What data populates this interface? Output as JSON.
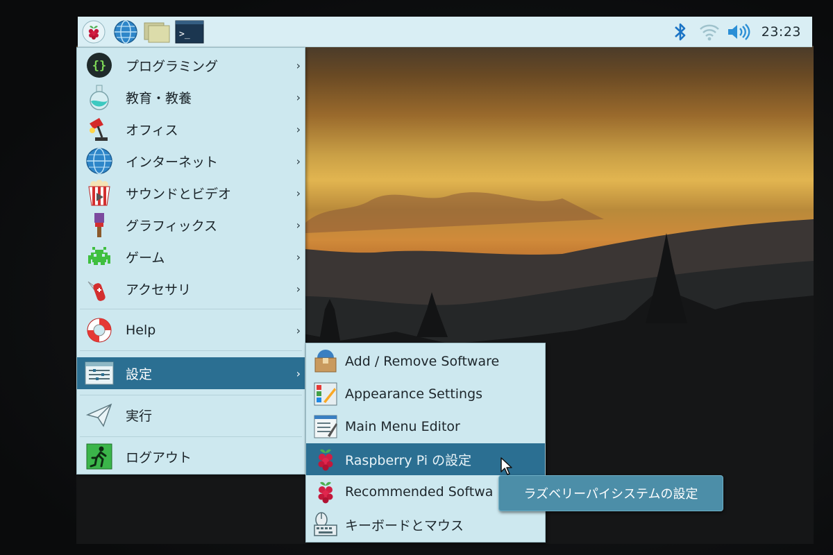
{
  "panel": {
    "launchers": [
      {
        "name": "raspberry-menu",
        "icon": "raspberry-icon"
      },
      {
        "name": "web-browser",
        "icon": "globe-icon"
      },
      {
        "name": "file-manager",
        "icon": "folder-icon"
      },
      {
        "name": "terminal",
        "icon": "terminal-icon"
      }
    ],
    "tray": [
      "bluetooth-icon",
      "wifi-icon",
      "volume-icon"
    ],
    "clock": "23:23"
  },
  "main_menu": {
    "items": [
      {
        "label": "プログラミング",
        "icon": "programming-icon",
        "has_submenu": true
      },
      {
        "label": "教育・教養",
        "icon": "education-flask-icon",
        "has_submenu": true
      },
      {
        "label": "オフィス",
        "icon": "office-lamp-icon",
        "has_submenu": true
      },
      {
        "label": "インターネット",
        "icon": "globe-icon",
        "has_submenu": true
      },
      {
        "label": "サウンドとビデオ",
        "icon": "popcorn-icon",
        "has_submenu": true
      },
      {
        "label": "グラフィックス",
        "icon": "paintbrush-icon",
        "has_submenu": true
      },
      {
        "label": "ゲーム",
        "icon": "space-invader-icon",
        "has_submenu": true
      },
      {
        "label": "アクセサリ",
        "icon": "swiss-knife-icon",
        "has_submenu": true
      },
      {
        "label": "Help",
        "icon": "lifebuoy-icon",
        "has_submenu": true
      },
      {
        "label": "設定",
        "icon": "settings-panel-icon",
        "has_submenu": true,
        "active": true
      },
      {
        "label": "実行",
        "icon": "paper-plane-icon",
        "has_submenu": false
      },
      {
        "label": "ログアウト",
        "icon": "exit-running-icon",
        "has_submenu": false
      }
    ],
    "arrow_glyph": "›"
  },
  "sub_menu": {
    "items": [
      {
        "label": "Add / Remove Software",
        "icon": "package-box-icon"
      },
      {
        "label": "Appearance Settings",
        "icon": "appearance-swatch-icon"
      },
      {
        "label": "Main Menu Editor",
        "icon": "menu-editor-icon"
      },
      {
        "label": "Raspberry Pi の設定",
        "icon": "raspberry-icon",
        "active": true
      },
      {
        "label": "Recommended Softwa",
        "icon": "raspberry-icon"
      },
      {
        "label": "キーボードとマウス",
        "icon": "keyboard-mouse-icon"
      }
    ]
  },
  "tooltip": {
    "text": "ラズベリーパイシステムの設定"
  },
  "colors": {
    "panel_bg": "#d9eef4",
    "menu_bg": "#cde8ef",
    "highlight": "#2b6f92",
    "tooltip_bg": "#4c8ea8"
  }
}
